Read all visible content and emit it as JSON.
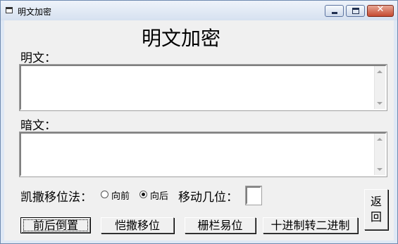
{
  "window": {
    "title": "明文加密",
    "controls": {
      "minimize": "—",
      "maximize": "□",
      "close": "✕"
    }
  },
  "form": {
    "heading": "明文加密",
    "plaintext_label": "明文：",
    "plaintext_value": "",
    "ciphertext_label": "暗文：",
    "ciphertext_value": "",
    "caesar_label": "凯撒移位法：",
    "direction_options": [
      {
        "label": "向前",
        "checked": false
      },
      {
        "label": "向后",
        "checked": true
      }
    ],
    "shift_label": "移动几位：",
    "shift_value": ""
  },
  "buttons": {
    "reverse": "前后倒置",
    "caesar": "恺撒移位",
    "railfence": "栅栏易位",
    "dec_to_bin": "十进制转二进制",
    "return_line1": "返",
    "return_line2": "回"
  }
}
